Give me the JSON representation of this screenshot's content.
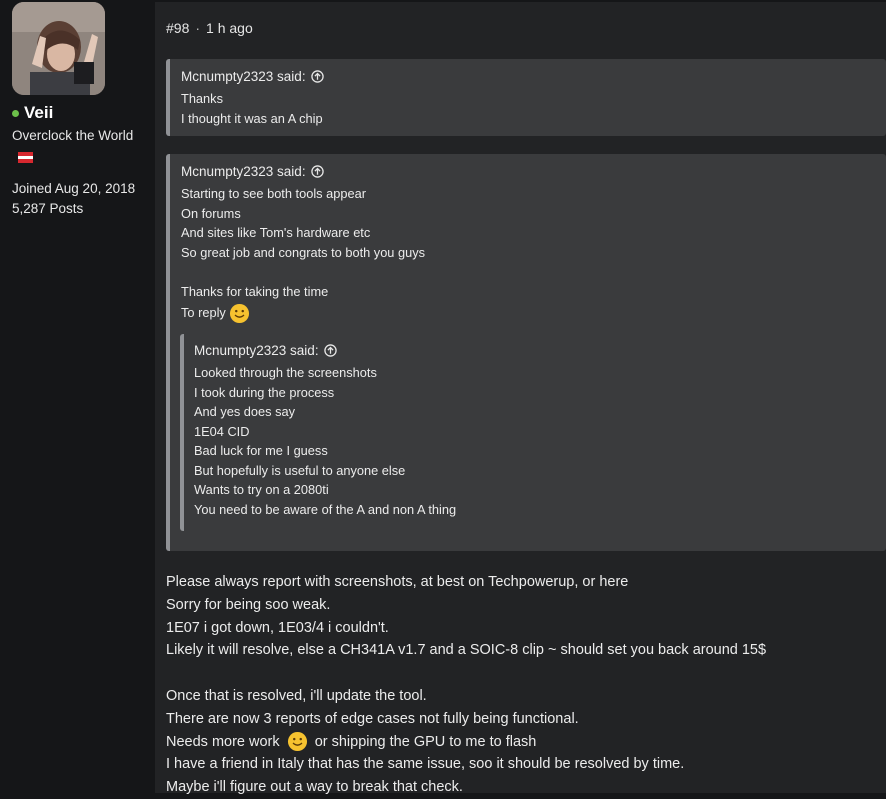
{
  "user": {
    "name": "Veii",
    "title": "Overclock the World",
    "joined": "Joined Aug 20, 2018",
    "posts": "5,287 Posts",
    "status_color": "#6cc04a",
    "flag": "austria-flag"
  },
  "post": {
    "number": "#98",
    "separator": "·",
    "time": "1 h ago",
    "quote1": {
      "author": "Mcnumpty2323 said:",
      "lines": [
        "Thanks",
        "I thought it was an A chip"
      ]
    },
    "quote2": {
      "author": "Mcnumpty2323 said:",
      "lines": [
        "Starting to see both tools appear",
        "On forums",
        "And sites like Tom's hardware etc",
        "So great job and congrats to both you guys",
        "",
        "Thanks for taking the time",
        "To reply"
      ],
      "nested": {
        "author": "Mcnumpty2323 said:",
        "lines": [
          "Looked through the screenshots",
          "I took during the process",
          "And yes does say",
          "1E04 CID",
          "Bad luck for me I guess",
          "But hopefully is useful to anyone else",
          "Wants to try on a 2080ti",
          "You need to be aware of the A and non A thing"
        ]
      }
    },
    "body": [
      "Please always report with screenshots, at best on Techpowerup, or here",
      "Sorry for being soo weak.",
      "1E07 i got down, 1E03/4 i couldn't.",
      "Likely it will resolve, else a CH341A v1.7 and a SOIC-8 clip ~ should set you back around 15$",
      "",
      "Once that is resolved, i'll update the tool.",
      "There are now 3 reports of edge cases not fully being functional.",
      "Needs more work",
      "or shipping the GPU to me to flash",
      "I have a friend in Italy that has the same issue, soo it should be resolved by time.",
      "Maybe i'll figure out a way to break that check."
    ]
  }
}
